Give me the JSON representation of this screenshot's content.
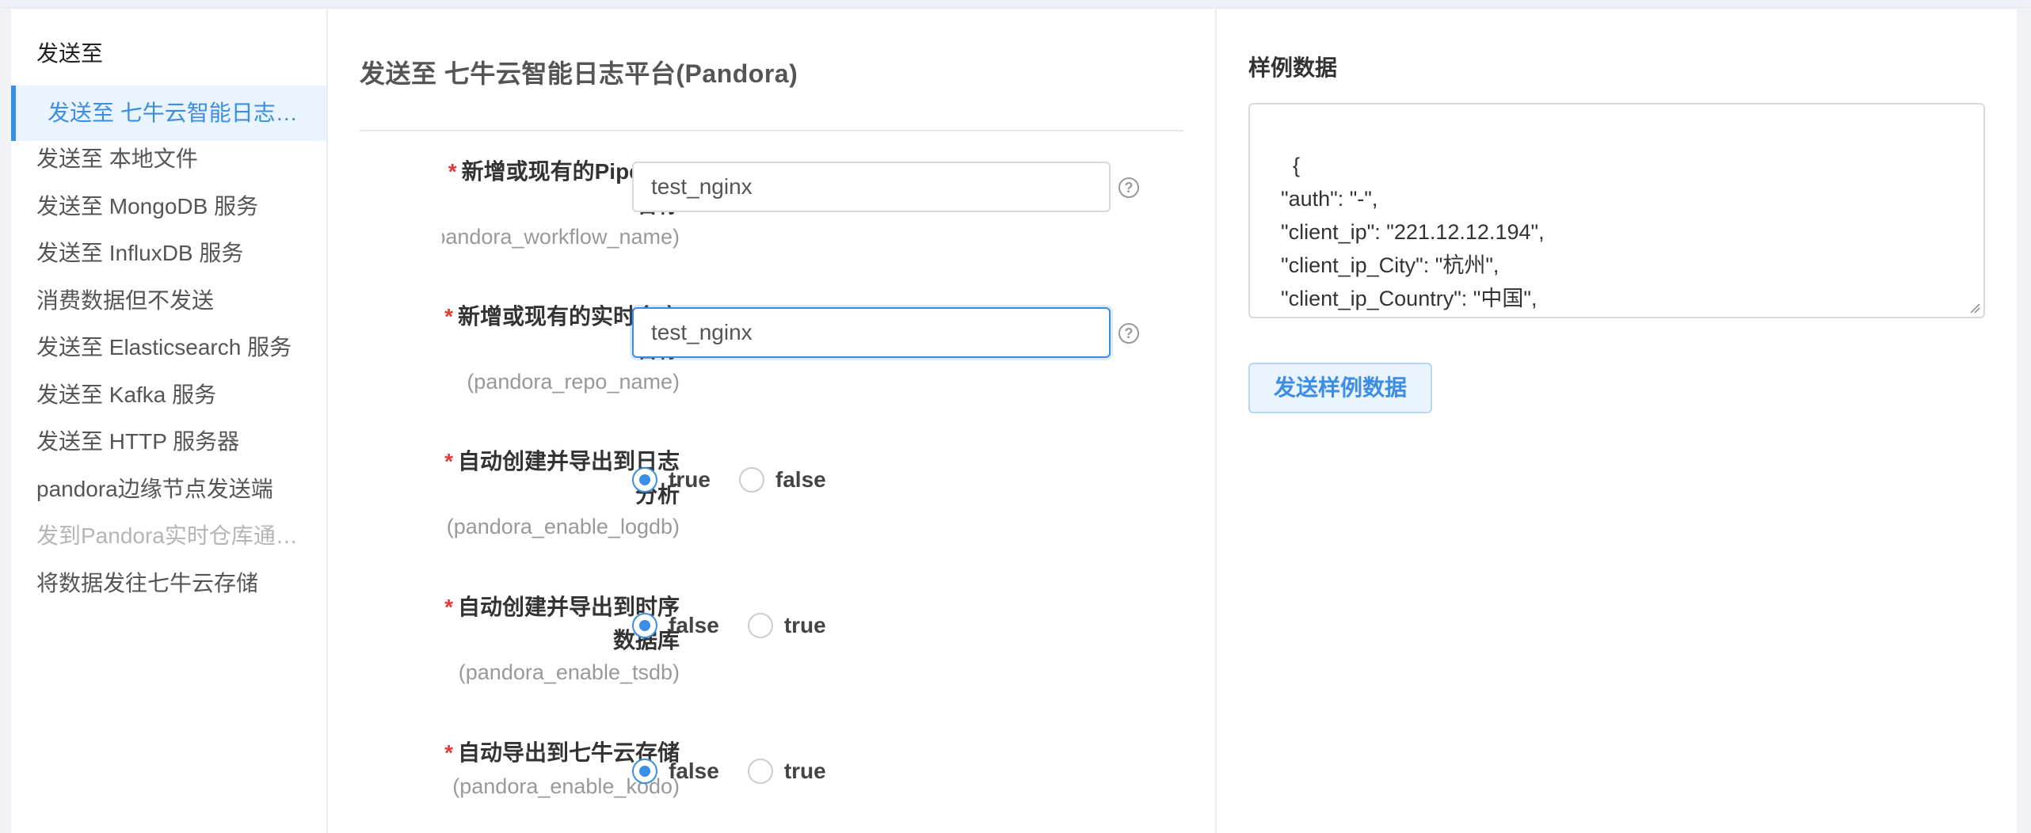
{
  "sidebar": {
    "title": "发送至",
    "items": [
      {
        "label": "发送至 七牛云智能日志…",
        "state": "active"
      },
      {
        "label": "发送至 本地文件",
        "state": "normal"
      },
      {
        "label": "发送至 MongoDB 服务",
        "state": "normal"
      },
      {
        "label": "发送至 InfluxDB 服务",
        "state": "normal"
      },
      {
        "label": "消费数据但不发送",
        "state": "normal"
      },
      {
        "label": "发送至 Elasticsearch 服务",
        "state": "normal"
      },
      {
        "label": "发送至 Kafka 服务",
        "state": "normal"
      },
      {
        "label": "发送至 HTTP 服务器",
        "state": "normal"
      },
      {
        "label": "pandora边缘节点发送端",
        "state": "normal"
      },
      {
        "label": "发到Pandora实时仓库通…",
        "state": "disabled"
      },
      {
        "label": "将数据发往七牛云存储",
        "state": "normal"
      }
    ]
  },
  "main": {
    "title": "发送至 七牛云智能日志平台(Pandora)",
    "fields": {
      "pipeline": {
        "required_mark": "*",
        "label_line1": "新增或现有的Pipeline",
        "label_line2": "名称",
        "key": "(pandora_workflow_name)",
        "value": "test_nginx",
        "help": "?"
      },
      "repo": {
        "required_mark": "*",
        "label_line1": "新增或现有的实时仓库",
        "label_line2": "名称",
        "key": "(pandora_repo_name)",
        "value": "test_nginx",
        "help": "?"
      },
      "logdb": {
        "required_mark": "*",
        "label_line1": "自动创建并导出到日志",
        "label_line2": "分析",
        "key": "(pandora_enable_logdb)",
        "options": [
          "true",
          "false"
        ],
        "selected": "true"
      },
      "tsdb": {
        "required_mark": "*",
        "label_line1": "自动创建并导出到时序",
        "label_line2": "数据库",
        "key": "(pandora_enable_tsdb)",
        "options": [
          "false",
          "true"
        ],
        "selected": "false"
      },
      "kodo": {
        "required_mark": "*",
        "label_line1": "自动导出到七牛云存储",
        "key": "(pandora_enable_kodo)",
        "options": [
          "false",
          "true"
        ],
        "selected": "false"
      }
    }
  },
  "right": {
    "title": "样例数据",
    "sample_text": "{\n  \"auth\": \"-\",\n  \"client_ip\": \"221.12.12.194\",\n  \"client_ip_City\": \"杭州\",\n  \"client_ip_Country\": \"中国\",\n  \"client_ip_CountryCode\": \"CN\",",
    "send_button": "发送样例数据"
  },
  "colors": {
    "accent": "#3b8de6",
    "required": "#e53935",
    "active_bg": "#eaf4fe"
  }
}
